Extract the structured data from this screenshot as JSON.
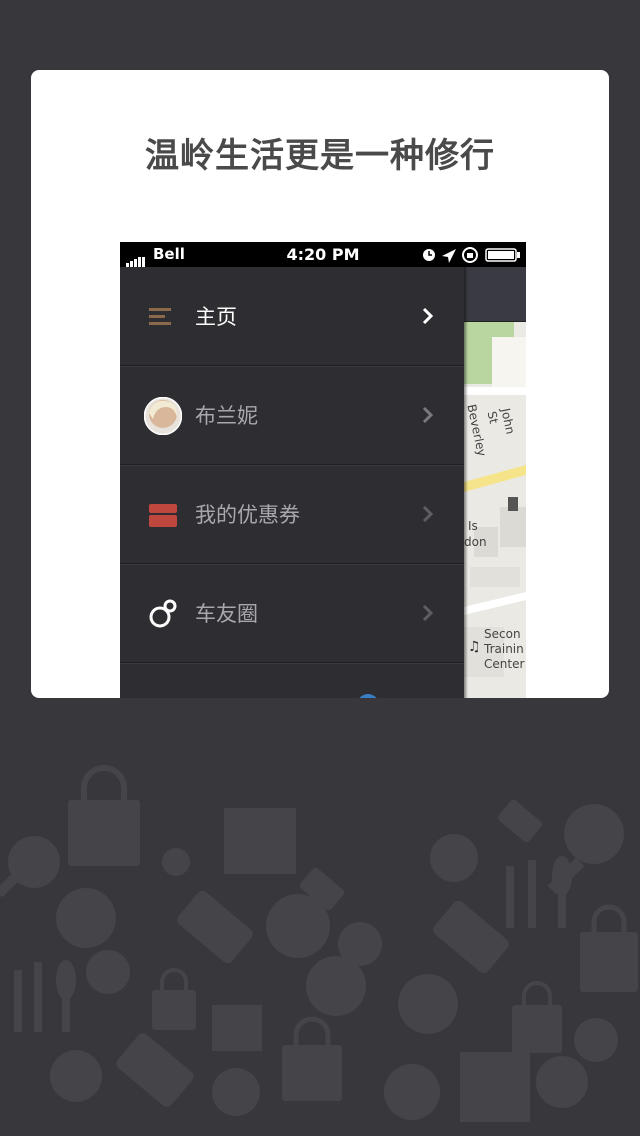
{
  "card": {
    "headline": "温岭生活更是一种修行"
  },
  "phone": {
    "status": {
      "carrier": "Bell",
      "time": "4:20 PM"
    },
    "menu": [
      {
        "label": "主页",
        "icon": "menu-lines-icon",
        "active": true
      },
      {
        "label": "布兰妮",
        "icon": "avatar",
        "active": false
      },
      {
        "label": "我的优惠券",
        "icon": "coupon-icon",
        "active": false
      },
      {
        "label": "车友圈",
        "icon": "circles-icon",
        "active": false
      }
    ],
    "map": {
      "streets": [
        "Beverley St",
        "John St"
      ],
      "labels": [
        "Is",
        "don",
        "Secon",
        "Trainin",
        "Center"
      ]
    }
  },
  "colors": {
    "background": "#38383c",
    "menu_bg": "#2e2e32",
    "coupon_red": "#c0473d",
    "menu_lines_brown": "#8a6a4a"
  }
}
